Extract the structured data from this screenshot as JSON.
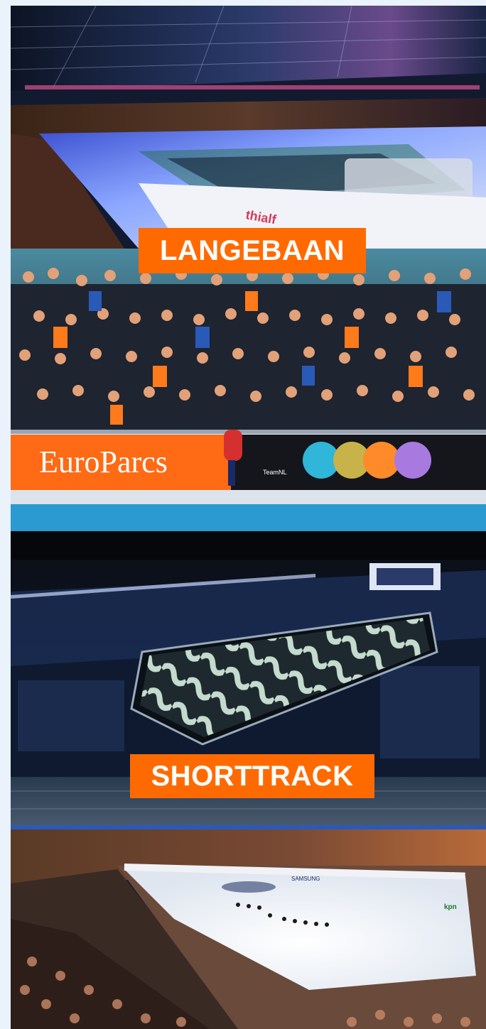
{
  "sections": [
    {
      "label": "LANGEBAAN",
      "photos": [
        {
          "icon": "speed-skating-arena-photo",
          "signage_text": "thialf"
        },
        {
          "icon": "crowd-and-skater-photo",
          "sponsor_text": "EuroParcs",
          "team_text": "TeamNL"
        }
      ]
    },
    {
      "label": "SHORTTRACK",
      "photos": [
        {
          "icon": "shorttrack-arena-projection-photo"
        },
        {
          "icon": "shorttrack-race-arena-photo",
          "board_text": "SAMSUNG",
          "board_text_2": "kpn"
        }
      ]
    }
  ],
  "colors": {
    "accent": "#ff6a00",
    "background": "#eaf3fb"
  }
}
